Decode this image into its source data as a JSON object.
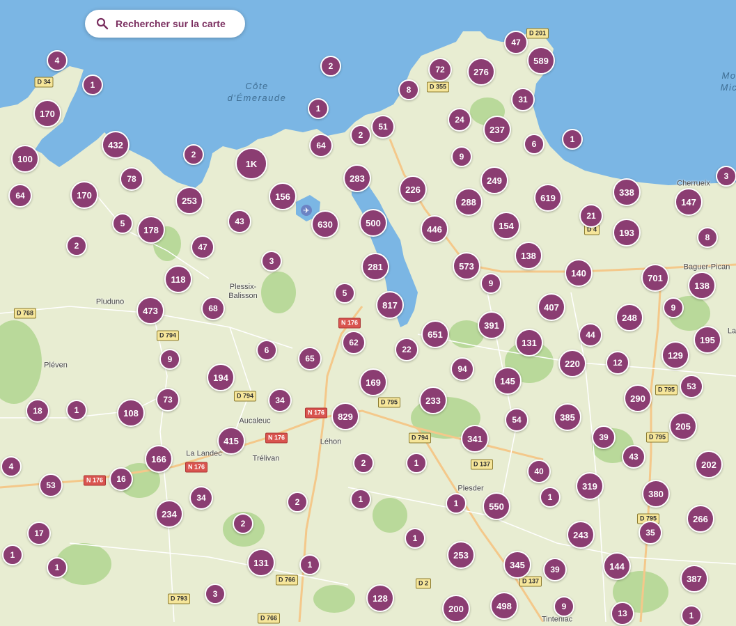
{
  "search": {
    "label": "Rechercher sur la carte",
    "icon": "search-icon"
  },
  "colors": {
    "water": "#7bb6e4",
    "land": "#e8edd2",
    "cluster": "#8b3d72",
    "park": "#b9d99a",
    "accent": "#7a2e5f"
  },
  "airport": {
    "label": "DN",
    "icon": "airplane-icon"
  },
  "places": [
    {
      "name": "Côte\nd'Émeraude",
      "kind": "sea"
    },
    {
      "name": "Mo\nMic",
      "kind": "sea"
    },
    {
      "name": "Cherrueix",
      "kind": "place"
    },
    {
      "name": "Baguer-Pican",
      "kind": "place"
    },
    {
      "name": "Plessix-\nBalisson",
      "kind": "place"
    },
    {
      "name": "Pluduno",
      "kind": "place"
    },
    {
      "name": "Pléven",
      "kind": "place"
    },
    {
      "name": "Aucaleuc",
      "kind": "place"
    },
    {
      "name": "La Landec",
      "kind": "place"
    },
    {
      "name": "Trélivan",
      "kind": "place"
    },
    {
      "name": "Léhon",
      "kind": "place"
    },
    {
      "name": "Plesder",
      "kind": "place"
    },
    {
      "name": "La",
      "kind": "place"
    },
    {
      "name": "Tinteniac",
      "kind": "place"
    }
  ],
  "roads": [
    {
      "label": "D 201",
      "type": "d"
    },
    {
      "label": "D 34",
      "type": "d"
    },
    {
      "label": "D 355",
      "type": "d"
    },
    {
      "label": "D 4",
      "type": "d"
    },
    {
      "label": "D 768",
      "type": "d"
    },
    {
      "label": "D 794",
      "type": "d"
    },
    {
      "label": "N 176",
      "type": "n"
    },
    {
      "label": "D 794",
      "type": "d"
    },
    {
      "label": "D 795",
      "type": "d"
    },
    {
      "label": "N 176",
      "type": "n"
    },
    {
      "label": "N 176",
      "type": "n"
    },
    {
      "label": "N 176",
      "type": "n"
    },
    {
      "label": "N 176",
      "type": "n"
    },
    {
      "label": "D 794",
      "type": "d"
    },
    {
      "label": "D 137",
      "type": "d"
    },
    {
      "label": "D 795",
      "type": "d"
    },
    {
      "label": "D 795",
      "type": "d"
    },
    {
      "label": "D 795",
      "type": "d"
    },
    {
      "label": "D 766",
      "type": "d"
    },
    {
      "label": "D 2",
      "type": "d"
    },
    {
      "label": "D 137",
      "type": "d"
    },
    {
      "label": "D 793",
      "type": "d"
    },
    {
      "label": "D 766",
      "type": "d"
    }
  ],
  "clusters": [
    "4",
    "1",
    "170",
    "100",
    "432",
    "2",
    "78",
    "64",
    "170",
    "253",
    "5",
    "178",
    "2",
    "1K",
    "156",
    "43",
    "47",
    "2",
    "1",
    "64",
    "2",
    "51",
    "8",
    "72",
    "276",
    "47",
    "589",
    "31",
    "24",
    "237",
    "6",
    "1",
    "9",
    "283",
    "226",
    "249",
    "288",
    "619",
    "338",
    "147",
    "3",
    "21",
    "193",
    "8",
    "630",
    "500",
    "446",
    "154",
    "138",
    "573",
    "9",
    "140",
    "701",
    "138",
    "281",
    "3",
    "817",
    "5",
    "407",
    "391",
    "248",
    "9",
    "118",
    "68",
    "473",
    "62",
    "651",
    "22",
    "131",
    "44",
    "195",
    "6",
    "65",
    "94",
    "220",
    "12",
    "129",
    "9",
    "194",
    "169",
    "145",
    "53",
    "290",
    "73",
    "34",
    "233",
    "18",
    "1",
    "108",
    "829",
    "385",
    "205",
    "54",
    "415",
    "341",
    "39",
    "166",
    "43",
    "202",
    "4",
    "2",
    "1",
    "40",
    "16",
    "53",
    "34",
    "319",
    "380",
    "2",
    "1",
    "1",
    "550",
    "234",
    "266",
    "2",
    "1",
    "243",
    "35",
    "17",
    "1",
    "253",
    "345",
    "39",
    "144",
    "131",
    "1",
    "387",
    "1",
    "1",
    "3",
    "128",
    "200",
    "498",
    "9",
    "13",
    "1"
  ]
}
